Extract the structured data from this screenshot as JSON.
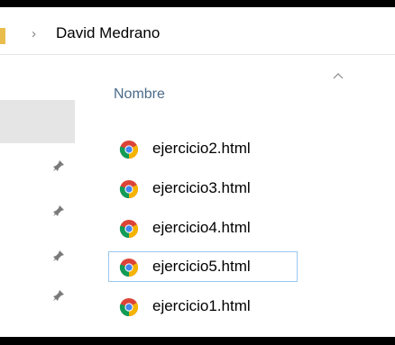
{
  "address": {
    "separator_icon": "chevron-right-icon",
    "folder_name": "David Medrano"
  },
  "column_header": {
    "name_label": "Nombre",
    "sort_icon": "sort-ascending-caret-icon"
  },
  "quick_access": {
    "pin_icon": "pin-icon"
  },
  "files": [
    {
      "name": "ejercicio2.html",
      "icon": "chrome-icon",
      "selected": false
    },
    {
      "name": "ejercicio3.html",
      "icon": "chrome-icon",
      "selected": false
    },
    {
      "name": "ejercicio4.html",
      "icon": "chrome-icon",
      "selected": false
    },
    {
      "name": "ejercicio5.html",
      "icon": "chrome-icon",
      "selected": true
    },
    {
      "name": "ejercicio1.html",
      "icon": "chrome-icon",
      "selected": false
    }
  ],
  "colors": {
    "header_text": "#4b6a8a",
    "selection_border": "#99c8f0",
    "nav_selection": "#e5e5e5",
    "folder_icon": "#e9bd4c"
  }
}
